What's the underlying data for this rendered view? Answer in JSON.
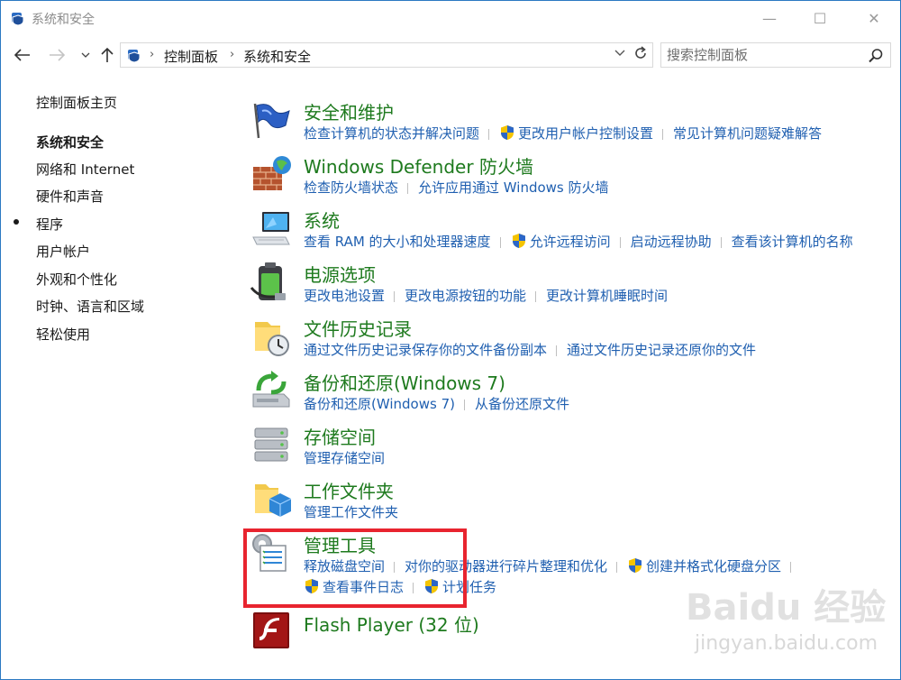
{
  "window": {
    "title": "系统和安全",
    "controls": {
      "minimize": "—",
      "maximize": "☐",
      "close": "✕"
    }
  },
  "address_bar": {
    "crumbs": [
      "控制面板",
      "系统和安全"
    ],
    "search_placeholder": "搜索控制面板"
  },
  "sidebar": {
    "items": [
      {
        "label": "控制面板主页",
        "active": false
      },
      {
        "label": "系统和安全",
        "active": true
      },
      {
        "label": "网络和 Internet",
        "active": false
      },
      {
        "label": "硬件和声音",
        "active": false
      },
      {
        "label": "程序",
        "active": false
      },
      {
        "label": "用户帐户",
        "active": false
      },
      {
        "label": "外观和个性化",
        "active": false
      },
      {
        "label": "时钟、语言和区域",
        "active": false
      },
      {
        "label": "轻松使用",
        "active": false
      }
    ]
  },
  "categories": [
    {
      "title": "安全和维护",
      "icon": "flag-icon",
      "links": [
        {
          "text": "检查计算机的状态并解决问题",
          "shield": false
        },
        {
          "text": "更改用户帐户控制设置",
          "shield": true
        },
        {
          "text": "常见计算机问题疑难解答",
          "shield": false
        }
      ]
    },
    {
      "title": "Windows Defender 防火墙",
      "icon": "firewall-icon",
      "links": [
        {
          "text": "检查防火墙状态",
          "shield": false
        },
        {
          "text": "允许应用通过 Windows 防火墙",
          "shield": false
        }
      ]
    },
    {
      "title": "系统",
      "icon": "computer-icon",
      "links": [
        {
          "text": "查看 RAM 的大小和处理器速度",
          "shield": false
        },
        {
          "text": "允许远程访问",
          "shield": true
        },
        {
          "text": "启动远程协助",
          "shield": false
        },
        {
          "text": "查看该计算机的名称",
          "shield": false
        }
      ]
    },
    {
      "title": "电源选项",
      "icon": "battery-icon",
      "links": [
        {
          "text": "更改电池设置",
          "shield": false
        },
        {
          "text": "更改电源按钮的功能",
          "shield": false
        },
        {
          "text": "更改计算机睡眠时间",
          "shield": false
        }
      ]
    },
    {
      "title": "文件历史记录",
      "icon": "file-history-icon",
      "links": [
        {
          "text": "通过文件历史记录保存你的文件备份副本",
          "shield": false
        },
        {
          "text": "通过文件历史记录还原你的文件",
          "shield": false
        }
      ]
    },
    {
      "title": "备份和还原(Windows 7)",
      "icon": "backup-icon",
      "links": [
        {
          "text": "备份和还原(Windows 7)",
          "shield": false
        },
        {
          "text": "从备份还原文件",
          "shield": false
        }
      ]
    },
    {
      "title": "存储空间",
      "icon": "storage-icon",
      "links": [
        {
          "text": "管理存储空间",
          "shield": false
        }
      ]
    },
    {
      "title": "工作文件夹",
      "icon": "work-folder-icon",
      "links": [
        {
          "text": "管理工作文件夹",
          "shield": false
        }
      ]
    },
    {
      "title": "管理工具",
      "icon": "admin-tools-icon",
      "links": [
        {
          "text": "释放磁盘空间",
          "shield": false
        },
        {
          "text": "对你的驱动器进行碎片整理和优化",
          "shield": false
        },
        {
          "text": "创建并格式化硬盘分区",
          "shield": true
        },
        {
          "text": "查看事件日志",
          "shield": true
        },
        {
          "text": "计划任务",
          "shield": true
        }
      ]
    },
    {
      "title": "Flash Player (32 位)",
      "icon": "flash-icon",
      "links": []
    }
  ],
  "watermark": {
    "text": "Baidu 经验",
    "sub": "jingyan.baidu.com"
  },
  "colors": {
    "title_green": "#1e7a1e",
    "link_blue": "#1f5fb0",
    "highlight_red": "#e8242f"
  }
}
